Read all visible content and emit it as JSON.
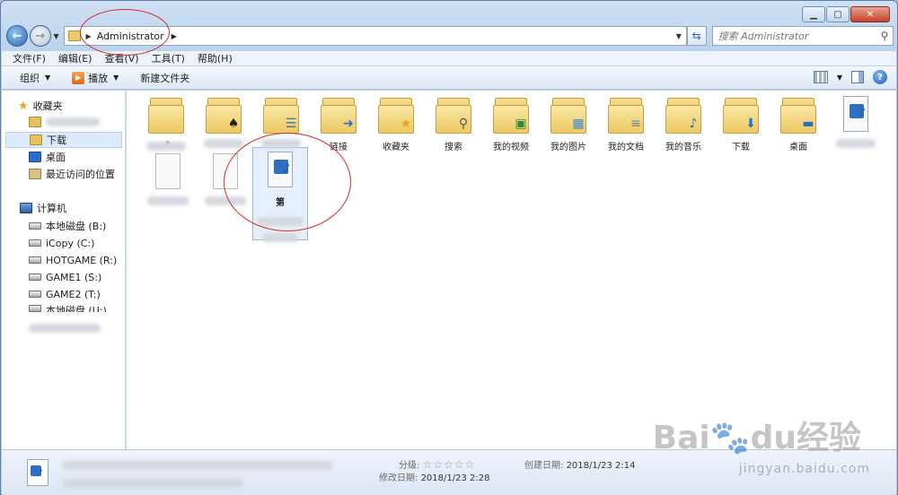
{
  "window": {
    "buttons": {
      "minimize": "▁",
      "maximize": "▢",
      "close": "✕"
    }
  },
  "address": {
    "path": "Administrator",
    "search_placeholder": "搜索 Administrator"
  },
  "menu": [
    "文件(F)",
    "编辑(E)",
    "查看(V)",
    "工具(T)",
    "帮助(H)"
  ],
  "toolbar": {
    "organize": "组织",
    "play": "播放",
    "new_folder": "新建文件夹"
  },
  "sidebar": {
    "favorites": "收藏夹",
    "downloads": "下载",
    "desktop": "桌面",
    "recent": "最近访问的位置",
    "computer": "计算机",
    "drives": [
      "本地磁盘 (B:)",
      "iCopy (C:)",
      "HOTGAME (R:)",
      "GAME1 (S:)",
      "GAME2 (T:)",
      "本地磁盘 (U:)"
    ]
  },
  "items": {
    "row1": [
      {
        "label": ".a",
        "icon": "folder-doc-icon"
      },
      {
        "label": "",
        "icon": "folder-spade-icon"
      },
      {
        "label": "",
        "icon": "folder-contact-icon"
      },
      {
        "label": "链接",
        "icon": "folder-link-icon"
      },
      {
        "label": "收藏夹",
        "icon": "folder-star-icon"
      },
      {
        "label": "搜索",
        "icon": "folder-search-icon"
      },
      {
        "label": "我的视频",
        "icon": "folder-video-icon"
      },
      {
        "label": "我的图片",
        "icon": "folder-picture-icon"
      },
      {
        "label": "我的文档",
        "icon": "folder-document-icon"
      },
      {
        "label": "我的音乐",
        "icon": "folder-music-icon"
      },
      {
        "label": "下载",
        "icon": "folder-download-icon"
      },
      {
        "label": "桌面",
        "icon": "folder-desktop-icon"
      },
      {
        "label": "",
        "icon": "media-file-icon"
      }
    ],
    "selected_label": "第"
  },
  "details": {
    "rating_label": "分级:",
    "rating_stars": "☆☆☆☆☆",
    "modified_label": "修改日期:",
    "modified_value": "2018/1/23 2:28",
    "created_label": "创建日期:",
    "created_value": "2018/1/23 2:14"
  },
  "watermark": {
    "brand": "Bai",
    "brand2": "du",
    "brand3": "经验",
    "url": "jingyan.baidu.com"
  },
  "colors": {
    "accent": "#2a66b6",
    "annotation": "#d32d27",
    "selection": "#e6f0fc"
  }
}
